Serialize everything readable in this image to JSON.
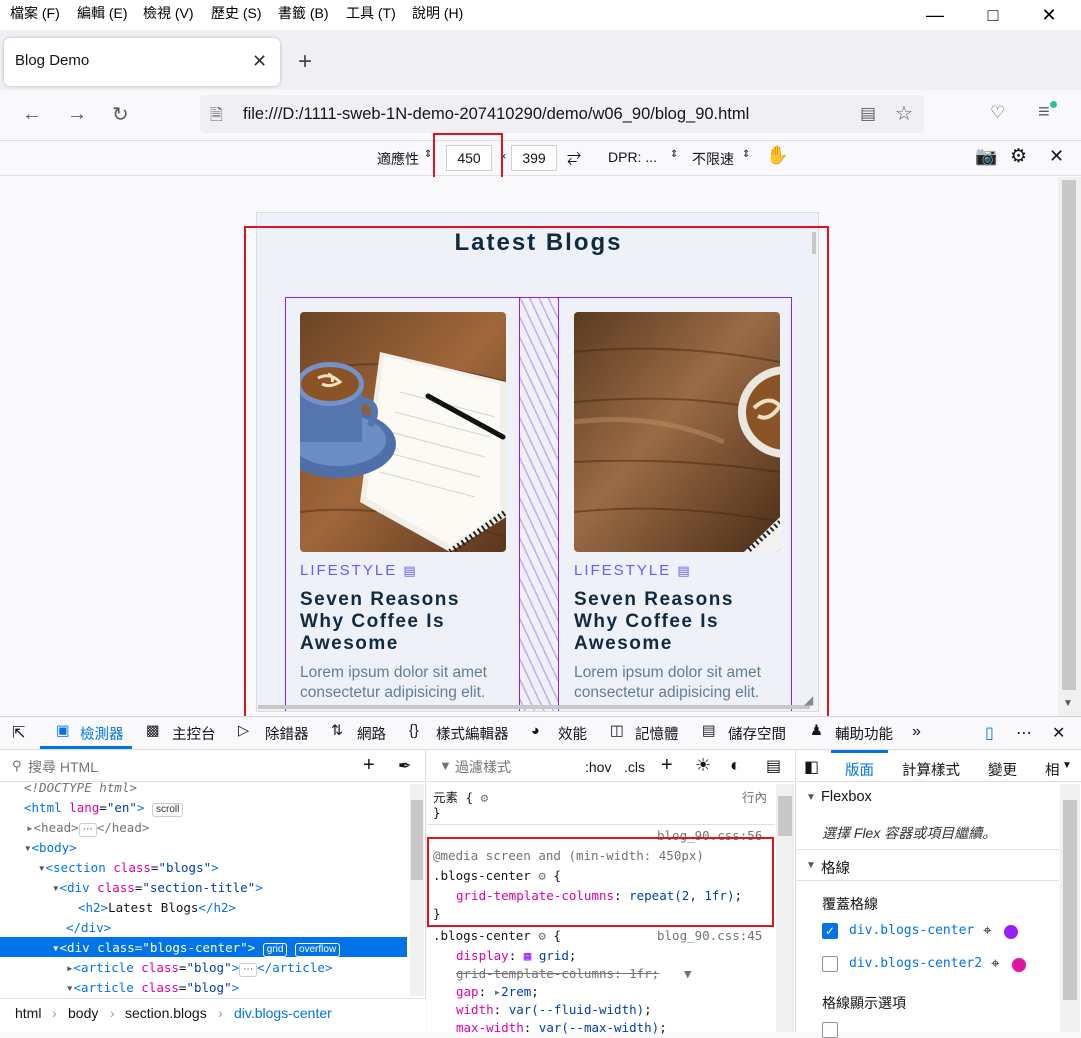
{
  "menu": [
    "檔案 (F)",
    "編輯 (E)",
    "檢視 (V)",
    "歷史 (S)",
    "書籤 (B)",
    "工具 (T)",
    "說明 (H)"
  ],
  "tab": {
    "title": "Blog Demo"
  },
  "url": "file:///D:/1111-sweb-1N-demo-207410290/demo/w06_90/blog_90.html",
  "rdm": {
    "device": "適應性",
    "width": "450",
    "height": "399",
    "dpr": "DPR: ...",
    "throttle": "不限速"
  },
  "page": {
    "title": "Latest Blogs",
    "cards": [
      {
        "category": "LIFESTYLE",
        "title": "Seven Reasons Why Coffee Is Awesome",
        "desc": "Lorem ipsum dolor sit amet consectetur adipisicing elit."
      },
      {
        "category": "LIFESTYLE",
        "title": "Seven Reasons Why Coffee Is Awesome",
        "desc": "Lorem ipsum dolor sit amet consectetur adipisicing elit."
      }
    ]
  },
  "devtools": {
    "tabs": [
      "檢測器",
      "主控台",
      "除錯器",
      "網路",
      "樣式編輯器",
      "效能",
      "記憶體",
      "儲存空間",
      "輔助功能"
    ],
    "search_placeholder": "搜尋 HTML",
    "filter_placeholder": "過濾樣式",
    "hov": ":hov",
    "cls": ".cls",
    "breadcrumb": [
      "html",
      "body",
      "section.blogs",
      "div.blogs-center"
    ],
    "right_tabs": [
      "版面",
      "計算樣式",
      "變更",
      "相"
    ],
    "flexbox": "Flexbox",
    "flex_hint": "選擇 Flex 容器或項目繼續。",
    "grid": "格線",
    "overlay": "覆蓋格線",
    "grid_items": [
      "div.blogs-center",
      "div.blogs-center2"
    ],
    "display_opts": "格線顯示選項",
    "inline": "行內",
    "css_file1": "blog_90.css:56",
    "css_file2": "blog_90.css:45",
    "colors": {
      "accent": "#0074e8",
      "grid_purple": "#9420ff",
      "grid_pink": "#e0149f",
      "highlight": "#e0141e"
    }
  }
}
